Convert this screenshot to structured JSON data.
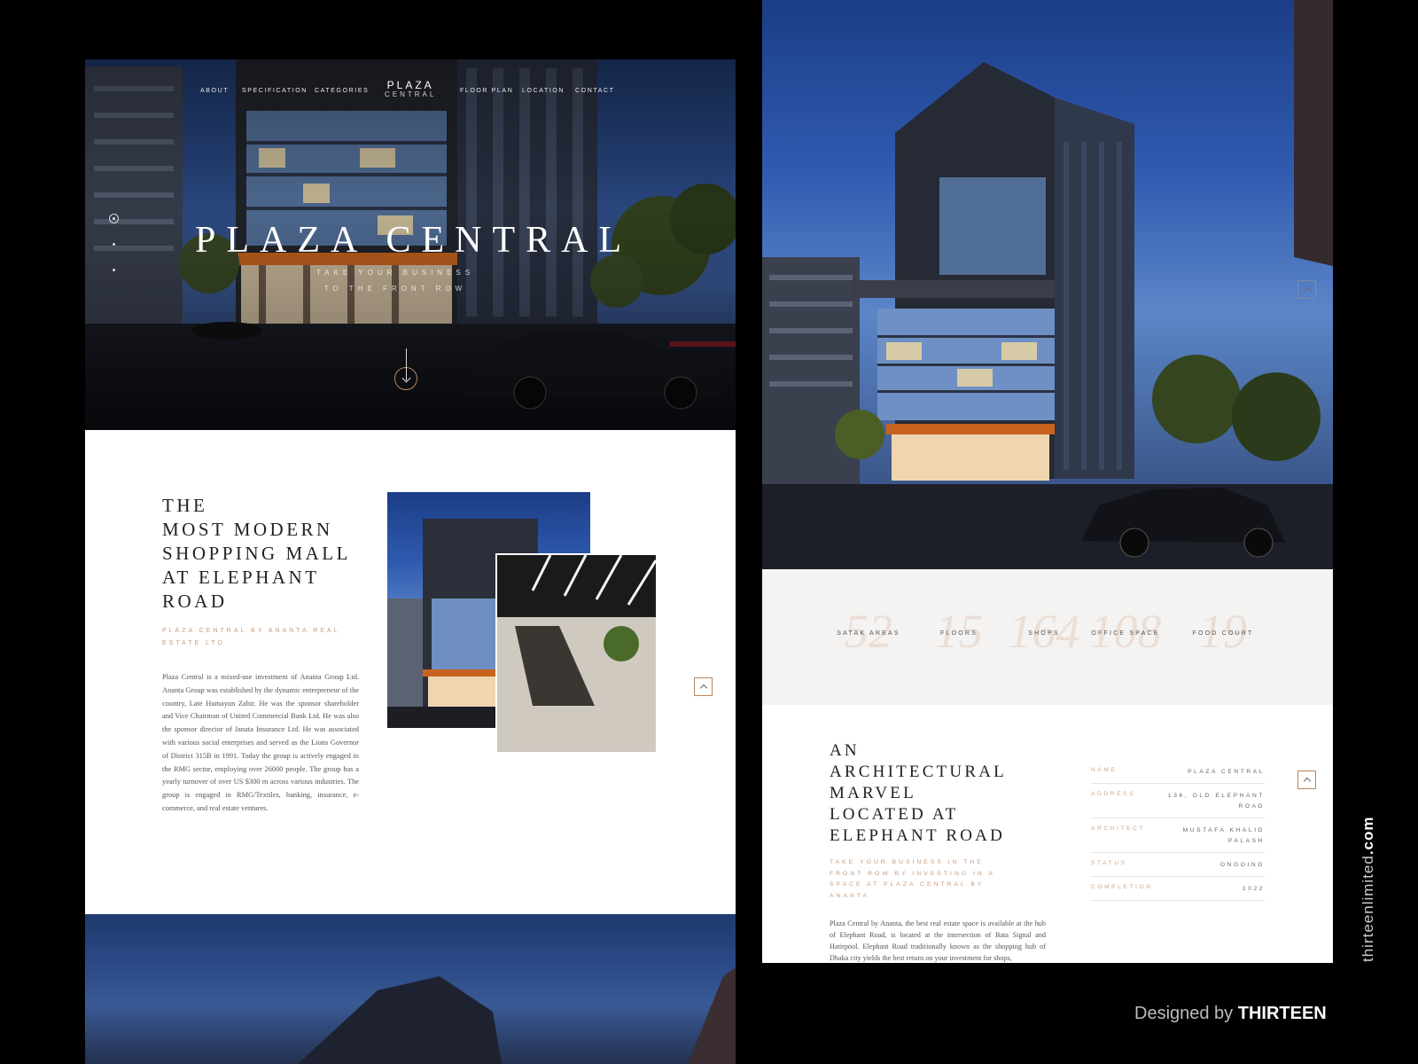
{
  "nav": {
    "items_left": [
      "ABOUT",
      "SPECIFICATION",
      "CATEGORIES"
    ],
    "logo_line1": "PLAZA",
    "logo_line2": "CENTRAL",
    "items_right": [
      "FLOOR PLAN",
      "LOCATION",
      "CONTACT"
    ]
  },
  "hero": {
    "title": "PLAZA CENTRAL",
    "subtitle_line1": "TAKE YOUR BUSINESS",
    "subtitle_line2": "TO THE FRONT ROW"
  },
  "about": {
    "title_lines": [
      "THE",
      "MOST MODERN",
      "SHOPPING MALL",
      "AT ELEPHANT",
      "ROAD"
    ],
    "tagline": "PLAZA CENTRAL BY ANANTA REAL ESTATE LTD",
    "body": "Plaza Central is a mixed-use investment of Ananta Group Ltd. Ananta Group was established by the dynamic entrepreneur of the country, Late Humayun Zahir. He was the sponsor shareholder and Vice Chairman of United Commercial Bank Ltd. He was also the sponsor director of Janata Insurance Ltd. He was associated with various social enterprises and served as the Lions Governor of District 315B in 1991. Today the group is actively engaged in the RMG sector, employing over 26000 people. The group has a yearly turnover of over US $300 m across various industries. The group is engaged in RMG/Textiles, banking, insurance, e-commerce, and real estate ventures."
  },
  "stats": [
    {
      "number": "52",
      "label": "SATAK AREAS"
    },
    {
      "number": "15",
      "label": "FLOORS"
    },
    {
      "number": "164",
      "label": "SHOPS"
    },
    {
      "number": "108",
      "label": "OFFICE SPACE"
    },
    {
      "number": "19",
      "label": "FOOD COURT"
    }
  ],
  "info": {
    "title_lines": [
      "AN",
      "ARCHITECTURAL",
      "MARVEL",
      "LOCATED AT",
      "ELEPHANT ROAD"
    ],
    "tagline": "TAKE YOUR BUSINESS IN THE FRONT ROW BY INVESTING IN A SPACE AT PLAZA CENTRAL BY ANANTA",
    "body": "Plaza Central by Ananta, the best real estate space is available at the hub of Elephant Road, is located at the intersection of Bata Signal and Hatirpool. Elephant Road traditionally known as the shopping hub of Dhaka city yields the best return on your investment for shops,",
    "specs": [
      {
        "key": "NAME",
        "value": "PLAZA CENTRAL"
      },
      {
        "key": "ADDRESS",
        "value": "136, OLD ELEPHANT ROAD"
      },
      {
        "key": "ARCHITECT",
        "value": "MUSTAFA KHALID PALASH"
      },
      {
        "key": "STATUS",
        "value": "ONGOING"
      },
      {
        "key": "COMPLETION",
        "value": "2022"
      }
    ]
  },
  "credit": {
    "side_prefix": "thirteenlimited",
    "side_suffix": ".com",
    "designed_prefix": "Designed by",
    "designed_brand": "THIRTEEN"
  },
  "colors": {
    "accent": "#c79b7c",
    "background": "#000000",
    "panel": "#ffffff",
    "stats_bg": "#f4f3f1"
  },
  "icons": {
    "scroll": "arrow-down-circle-icon",
    "back_to_top": "chevron-up-icon"
  }
}
